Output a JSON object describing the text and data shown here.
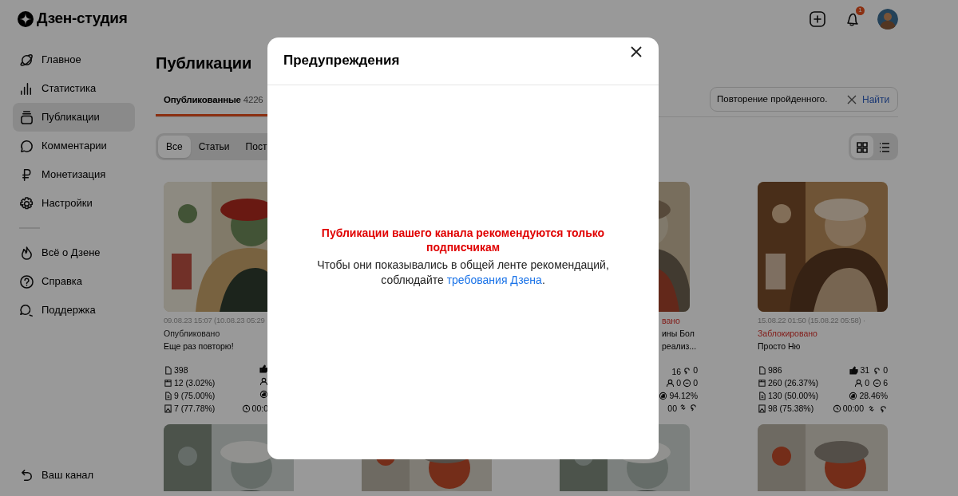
{
  "app": {
    "logo": "Дзен-студия"
  },
  "header": {
    "notifications": "1"
  },
  "sidebar": {
    "items": [
      {
        "kind": "planet",
        "label": "Главное",
        "selected": false
      },
      {
        "kind": "stats",
        "label": "Статистика",
        "selected": false
      },
      {
        "kind": "stack",
        "label": "Публикации",
        "selected": true
      },
      {
        "kind": "comment",
        "label": "Комментарии",
        "selected": false
      },
      {
        "kind": "ruble",
        "label": "Монетизация",
        "selected": false
      },
      {
        "kind": "gear",
        "label": "Настройки",
        "selected": false
      },
      {
        "kind": "divider"
      },
      {
        "kind": "fire",
        "label": "Всё о Дзене",
        "selected": false
      },
      {
        "kind": "help",
        "label": "Справка",
        "selected": false
      },
      {
        "kind": "support",
        "label": "Поддержка",
        "selected": false
      }
    ],
    "footer": "Ваш канал"
  },
  "page": {
    "title": "Публикации",
    "tabs": [
      {
        "label": "Опубликованные",
        "count": "4226",
        "selected": true
      }
    ],
    "search": {
      "value": "Повторение пройденного.",
      "button": "Найти"
    },
    "filters": [
      {
        "label": "Все",
        "selected": true
      },
      {
        "label": "Статьи",
        "selected": false
      },
      {
        "label": "Пост",
        "selected": false
      }
    ],
    "view_modes": [
      {
        "kind": "grid",
        "selected": true
      },
      {
        "kind": "list",
        "selected": false
      }
    ],
    "cards": [
      {
        "date": "09.08.23 15:07 (10.08.23 05:29",
        "status": "Опубликовано",
        "blocked": false,
        "title_lines": [
          "Еще раз повторю!"
        ],
        "stats": [
          {
            "left": {
              "kind": "views",
              "value": "398"
            },
            "right": [
              {
                "kind": "likes"
              }
            ]
          },
          {
            "left": {
              "kind": "shows",
              "value": "12 (3.02%)"
            },
            "right": [
              {
                "kind": "subscribers"
              }
            ]
          },
          {
            "left": {
              "kind": "reads",
              "value": "9 (75.00%)"
            },
            "right": [
              {
                "kind": "engagement"
              }
            ]
          },
          {
            "left": {
              "kind": "completion",
              "value": "7 (77.78%)"
            },
            "right": [
              {
                "kind": "time",
                "value": "00:0"
              }
            ]
          }
        ]
      },
      {
        "status": "вано",
        "blocked": true,
        "title_lines": [
          "ины Бол",
          "реализ..."
        ],
        "stats": [
          {
            "right": [
              {
                "kind": "text",
                "value": "16"
              },
              {
                "kind": "reposts",
                "value": "0"
              }
            ]
          },
          {
            "right": [
              {
                "kind": "subscribers",
                "value": "0"
              },
              {
                "kind": "comments",
                "value": "0"
              }
            ]
          },
          {
            "right": [
              {
                "kind": "engagement",
                "value": "94.12%"
              }
            ]
          },
          {
            "right": [
              {
                "kind": "text",
                "value": "00"
              },
              {
                "kind": "link"
              },
              {
                "kind": "reposts"
              }
            ]
          }
        ]
      },
      {
        "date": "15.08.22 01:50 (15.08.22 05:58) ·",
        "status": "Заблокировано",
        "blocked": true,
        "title_lines": [
          "Просто Ню"
        ],
        "stats": [
          {
            "left": {
              "kind": "views",
              "value": "986"
            },
            "right": [
              {
                "kind": "likes",
                "value": "31"
              },
              {
                "kind": "reposts",
                "value": "0"
              }
            ]
          },
          {
            "left": {
              "kind": "shows",
              "value": "260 (26.37%)"
            },
            "right": [
              {
                "kind": "subscribers",
                "value": "0"
              },
              {
                "kind": "comments",
                "value": "6"
              }
            ]
          },
          {
            "left": {
              "kind": "reads",
              "value": "130 (50.00%)"
            },
            "right": [
              {
                "kind": "engagement",
                "value": "28.46%"
              }
            ]
          },
          {
            "left": {
              "kind": "completion",
              "value": "98 (75.38%)"
            },
            "right": [
              {
                "kind": "time",
                "value": "00:00"
              },
              {
                "kind": "link"
              },
              {
                "kind": "reposts"
              }
            ]
          }
        ]
      }
    ]
  },
  "modal": {
    "title": "Предупреждения",
    "warning": "Публикации вашего канала рекомендуются только подписчикам",
    "text": "Чтобы они показывались в общей ленте рекомендаций, соблюдайте",
    "link": "требования Дзена",
    "after_link": "."
  }
}
